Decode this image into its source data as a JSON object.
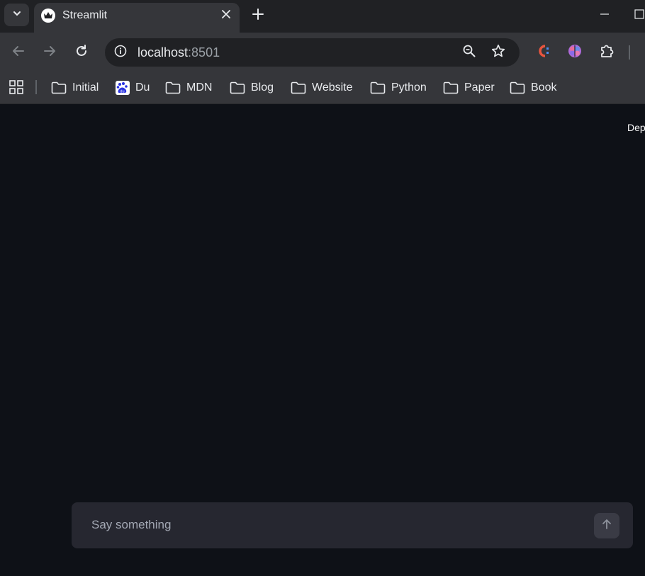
{
  "browser": {
    "tab": {
      "title": "Streamlit"
    },
    "address": {
      "host": "localhost",
      "port": ":8501"
    },
    "bookmarks": [
      {
        "label": "Initial",
        "icon": "folder-icon"
      },
      {
        "label": "Du",
        "icon": "baidu-icon"
      },
      {
        "label": "MDN",
        "icon": "folder-icon"
      },
      {
        "label": "Blog",
        "icon": "folder-icon"
      },
      {
        "label": "Website",
        "icon": "folder-icon"
      },
      {
        "label": "Python",
        "icon": "folder-icon"
      },
      {
        "label": "Paper",
        "icon": "folder-icon"
      },
      {
        "label": "Book",
        "icon": "folder-icon"
      }
    ]
  },
  "app": {
    "deploy_label": "Deploy",
    "chat": {
      "placeholder": "Say something"
    }
  },
  "colors": {
    "app_background": "#0e1117",
    "chat_input_background": "#262730",
    "browser_frame": "#35363a"
  }
}
